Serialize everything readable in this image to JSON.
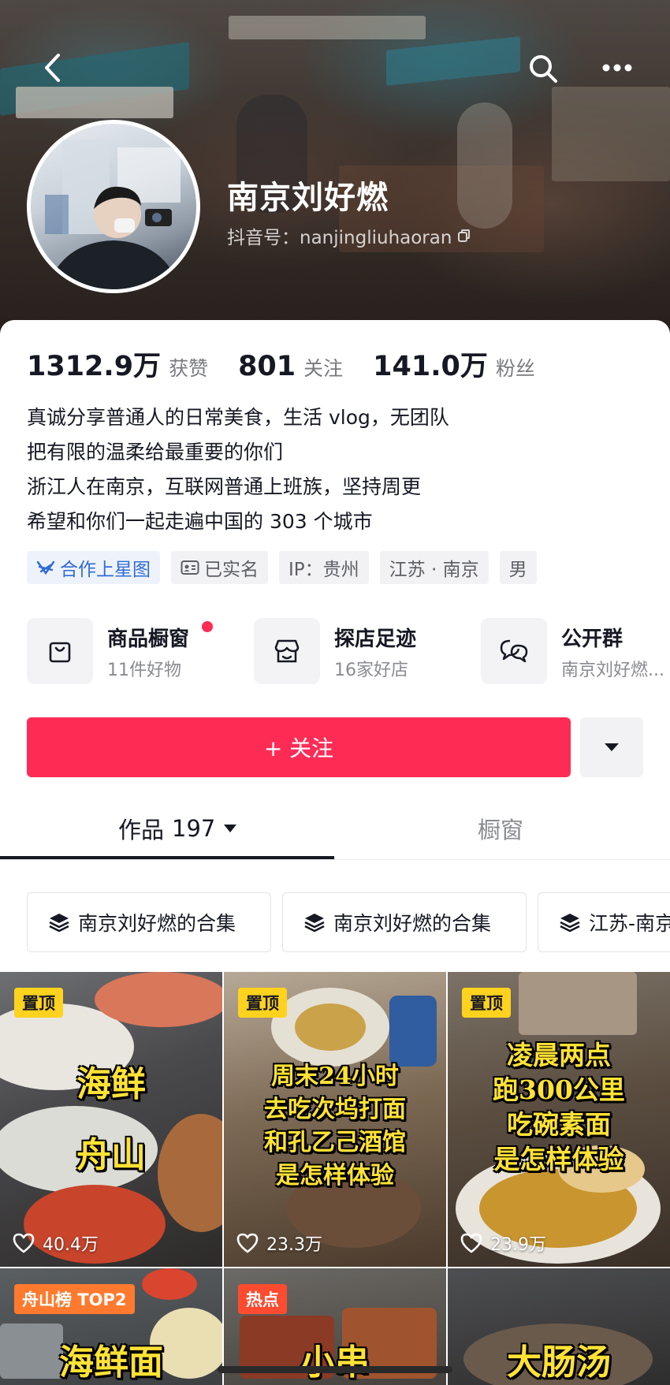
{
  "header": {
    "nickname": "南京刘好燃",
    "douyin_id": "抖音号：nanjingliuhaoran"
  },
  "stats": [
    {
      "value": "1312.9万",
      "label": "获赞"
    },
    {
      "value": "801",
      "label": "关注"
    },
    {
      "value": "141.0万",
      "label": "粉丝"
    }
  ],
  "bio": [
    "真诚分享普通人的日常美食，生活 vlog，无团队",
    "把有限的温柔给最重要的你们",
    "浙江人在南京，互联网普通上班族，坚持周更",
    "希望和你们一起走遍中国的 303 个城市"
  ],
  "tags": [
    "合作上星图",
    "已实名",
    "IP：贵州",
    "江苏 · 南京",
    "男"
  ],
  "features": [
    {
      "title": "商品橱窗",
      "subtitle": "11件好物",
      "icon": "bag-icon"
    },
    {
      "title": "探店足迹",
      "subtitle": "16家好店",
      "icon": "shop-icon"
    },
    {
      "title": "公开群",
      "subtitle": "南京刘好燃...",
      "icon": "chat-icon"
    }
  ],
  "follow_label": "+ 关注",
  "tabs": {
    "works_label": "作品",
    "works_count": "197",
    "showcase_label": "橱窗"
  },
  "collections": [
    "南京刘好燃的合集",
    "南京刘好燃的合集",
    "江苏-南京"
  ],
  "videos": [
    {
      "badge": "置顶",
      "overlay": [
        "海鲜",
        "舟山"
      ],
      "likes": "40.4万"
    },
    {
      "badge": "置顶",
      "overlay": [
        "周末24小时",
        "去吃次坞打面",
        "和孔乙己酒馆",
        "是怎样体验"
      ],
      "likes": "23.3万"
    },
    {
      "badge": "置顶",
      "overlay": [
        "凌晨两点",
        "跑300公里",
        "吃碗素面",
        "是怎样体验"
      ],
      "likes": "23.9万"
    },
    {
      "badge": "舟山榜 TOP2",
      "overlay": [
        "海鲜面"
      ],
      "likes": ""
    },
    {
      "badge": "热点",
      "overlay": [
        "小串"
      ],
      "likes": ""
    },
    {
      "badge": "",
      "overlay": [
        "大肠汤"
      ],
      "likes": ""
    }
  ],
  "colors": {
    "follow": "#fe2c55",
    "text": "#161823",
    "secondary": "#8a8b90",
    "pin_badge": "#ffd21e"
  }
}
